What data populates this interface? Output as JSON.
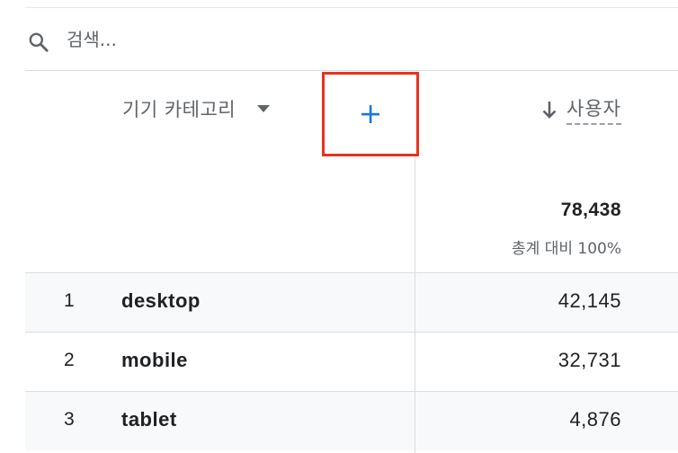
{
  "search": {
    "placeholder": "검색...",
    "icon": "search-icon"
  },
  "header": {
    "dimension_label": "기기 카테고리",
    "dimension_dropdown_icon": "dropdown-arrow-icon",
    "add_dimension_icon": "plus-icon",
    "sort_icon": "arrow-down-icon",
    "metric_label": "사용자"
  },
  "totals": {
    "value": "78,438",
    "caption": "총계 대비 100%"
  },
  "rows": [
    {
      "index": "1",
      "dimension": "desktop",
      "metric": "42,145"
    },
    {
      "index": "2",
      "dimension": "mobile",
      "metric": "32,731"
    },
    {
      "index": "3",
      "dimension": "tablet",
      "metric": "4,876"
    }
  ],
  "colors": {
    "highlight_border": "#e8321c",
    "accent": "#1a73e8",
    "row_shade": "#f8f9fa",
    "divider": "#dadce0"
  }
}
